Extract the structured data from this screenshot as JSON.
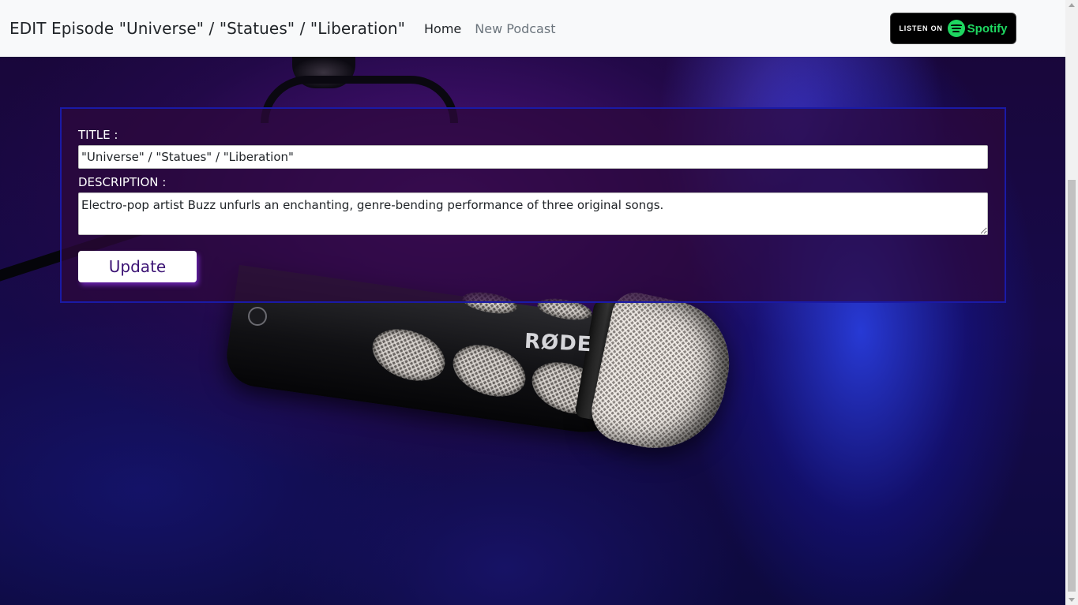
{
  "navbar": {
    "brand": "EDIT Episode \"Universe\" / \"Statues\" / \"Liberation\"",
    "links": [
      {
        "label": "Home",
        "state": "active"
      },
      {
        "label": "New Podcast",
        "state": "muted"
      }
    ],
    "spotify_badge": {
      "prefix": "LISTEN ON",
      "brand": "Spotify",
      "icon": "spotify-logo-icon",
      "color": "#1ed760"
    }
  },
  "background": {
    "mic_logo": "RØDE"
  },
  "form": {
    "title_label": "TITLE :",
    "title_value": "\"Universe\" / \"Statues\" / \"Liberation\"",
    "description_label": "DESCRIPTION :",
    "description_value": "Electro-pop artist Buzz unfurls an enchanting, genre-bending performance of three original songs.",
    "submit_label": "Update",
    "border_color": "#1a1aa6",
    "button_text_color": "#3b1274"
  }
}
